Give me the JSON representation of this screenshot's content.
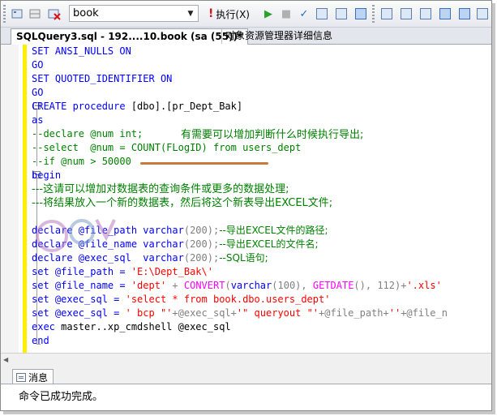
{
  "toolbar": {
    "database": "book",
    "execute_label": "执行(X)"
  },
  "tabs": {
    "active": "SQLQuery3.sql - 192....10.book (sa (55))*",
    "other": "对象资源管理器详细信息"
  },
  "code_lines": {
    "l1": "SET ANSI_NULLS ON",
    "l2": "GO",
    "l3": "SET QUOTED_IDENTIFIER ON",
    "l4": "GO",
    "l5_kw": "CREATE procedure ",
    "l5_name": "[dbo].[pr_Dept_Bak]",
    "l6": "as",
    "l7": "--declare @num int;",
    "l8": "--select  @num = COUNT(FLogID) from users_dept",
    "l9": "--if @num > 50000",
    "l10": "begin",
    "l11": "---这请可以增加对数据表的查询条件或更多的数据处理;",
    "l12": "---将结果放入一个新的数据表，然后将这个新表导出EXCEL文件;",
    "l14_a": "declare @file_path ",
    "l14_b": "varchar",
    "l14_c": "(200);",
    "l14_d": "--导出EXCEL文件的路径;",
    "l15_a": "declare @file_name ",
    "l15_b": "varchar",
    "l15_c": "(200);",
    "l15_d": "--导出EXCEL的文件名;",
    "l16_a": "declare @exec_sql  ",
    "l16_b": "varchar",
    "l16_c": "(200);",
    "l16_d": "--SQL语句;",
    "l17_a": "set @file_path = ",
    "l17_b": "'E:\\Dept_Bak\\'",
    "l18_a": "set @file_name = ",
    "l18_b": "'dept'",
    "l18_c": " + ",
    "l18_d": "CONVERT",
    "l18_e": "(",
    "l18_f": "varchar",
    "l18_g": "(100), ",
    "l18_h": "GETDATE",
    "l18_i": "(), 112)+",
    "l18_j": "'.xls'",
    "l19_a": "set @exec_sql = ",
    "l19_b": "'select * from book.dbo.users_dept'",
    "l20_a": "set @exec_sql = ",
    "l20_b": "' bcp \"'",
    "l20_c": "+@exec_sql+",
    "l20_d": "'\" queryout \"'",
    "l20_e": "+@file_path+",
    "l20_f": "''",
    "l20_g": "+@file_n",
    "l21_a": "exec ",
    "l21_b": "master..xp_cmdshell @exec_sql",
    "l22": "end"
  },
  "annotation": "有需要可以增加判断什么时候执行导出;",
  "messages": {
    "tab_label": "消息",
    "text": "命令已成功完成。"
  },
  "colors": {
    "keyword": "#0000ff",
    "comment": "#008000",
    "string": "#ff0000",
    "function": "#ff00ff"
  }
}
